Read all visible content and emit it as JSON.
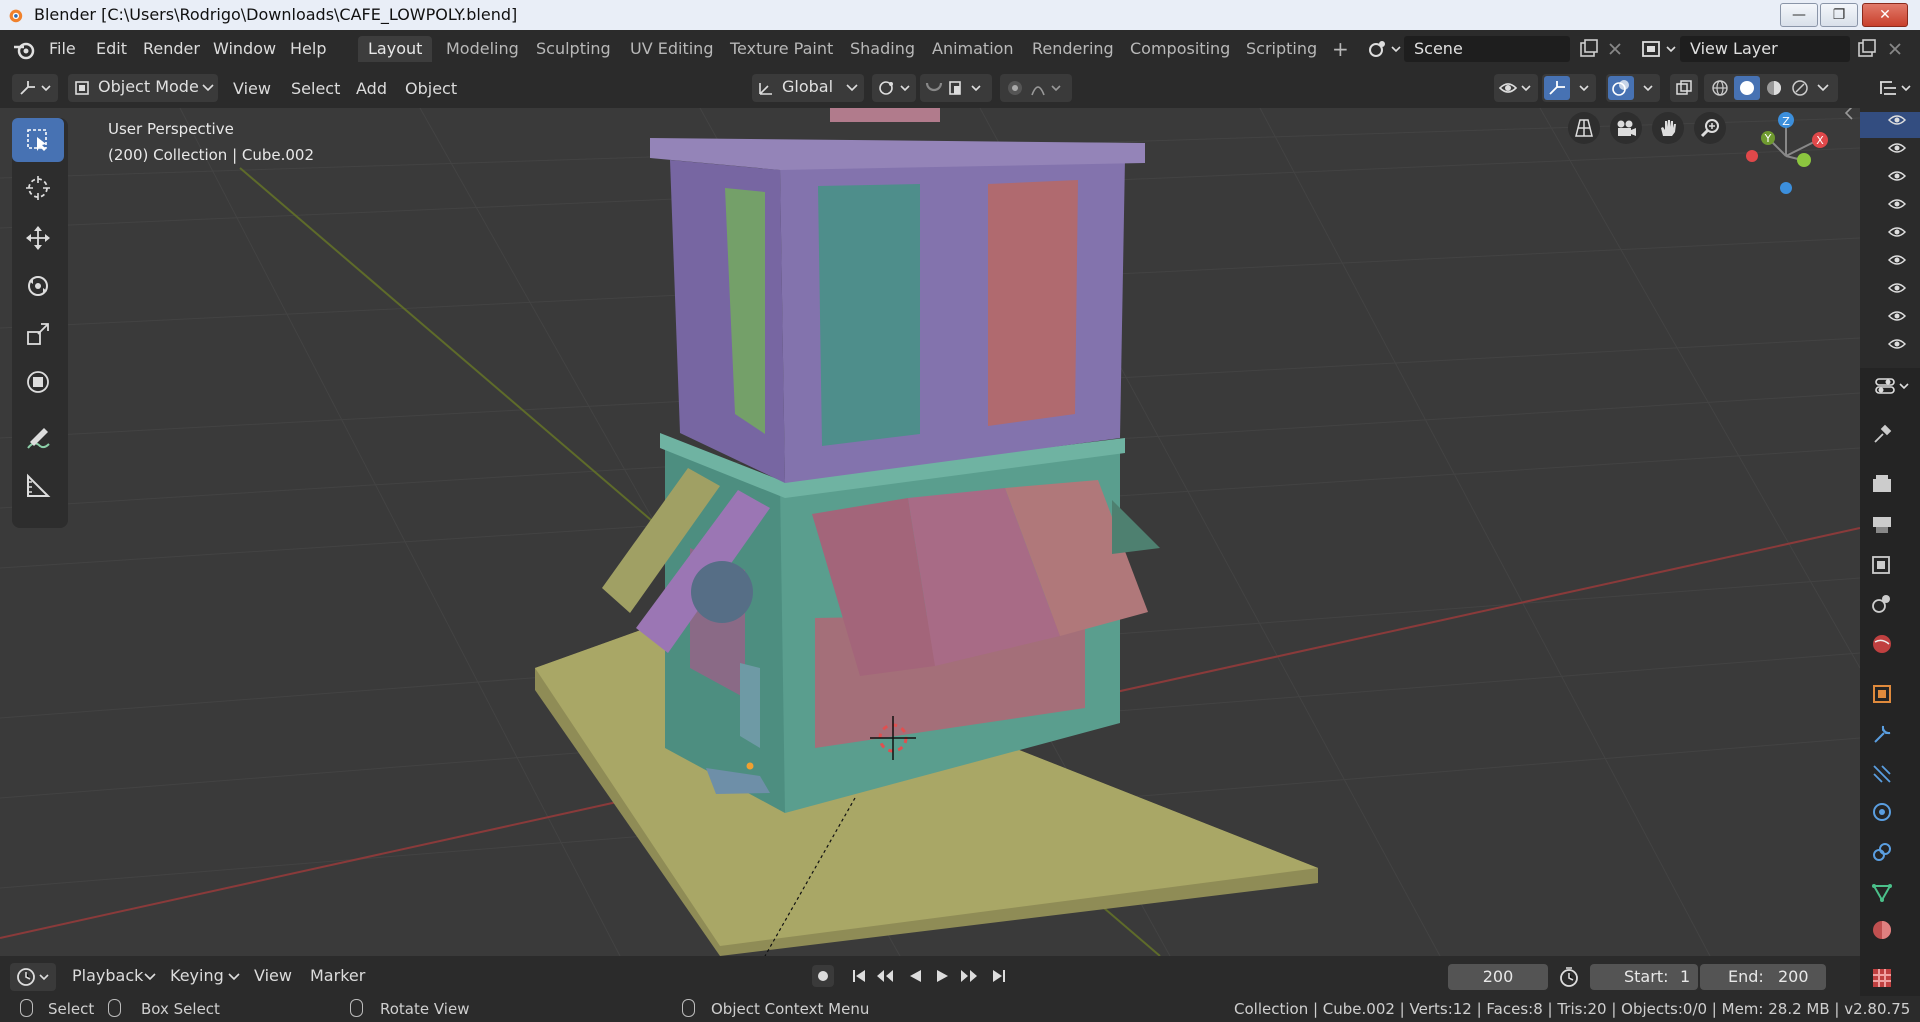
{
  "window": {
    "title": "Blender [C:\\Users\\Rodrigo\\Downloads\\CAFE_LOWPOLY.blend]",
    "min_symbol": "—",
    "restore_symbol": "❐",
    "close_symbol": "✕"
  },
  "menu": [
    "File",
    "Edit",
    "Render",
    "Window",
    "Help"
  ],
  "workspaces": [
    "Layout",
    "Modeling",
    "Sculpting",
    "UV Editing",
    "Texture Paint",
    "Shading",
    "Animation",
    "Rendering",
    "Compositing",
    "Scripting"
  ],
  "active_workspace": "Layout",
  "add_workspace": "+",
  "scene": {
    "name": "Scene"
  },
  "view_layer": {
    "name": "View Layer"
  },
  "header": {
    "mode": "Object Mode",
    "menus": [
      "View",
      "Select",
      "Add",
      "Object"
    ],
    "transform_orientation": "Global"
  },
  "viewport": {
    "perspective": "User Perspective",
    "context": "(200) Collection | Cube.002",
    "gizmo": {
      "x": "X",
      "y": "Y",
      "z": "Z"
    }
  },
  "tools": [
    "select-box",
    "cursor",
    "move",
    "rotate",
    "scale",
    "transform",
    "annotate",
    "measure"
  ],
  "outliner_visible_rows": 9,
  "timeline": {
    "menus": [
      "Playback",
      "Keying",
      "View",
      "Marker"
    ],
    "current_frame": "200",
    "start_label": "Start:",
    "start": "1",
    "end_label": "End:",
    "end": "200"
  },
  "status": {
    "select": "Select",
    "box_select": "Box Select",
    "rotate_view": "Rotate View",
    "context_menu": "Object Context Menu",
    "stats": "Collection | Cube.002 | Verts:12 | Faces:8 | Tris:20 | Objects:0/0 | Mem: 28.2 MB | v2.80.75"
  },
  "colors": {
    "accent": "#4772b3",
    "viewport_bg": "#3a3a3a",
    "x_axis": "#e0484a",
    "y_axis": "#8cc63f",
    "z_axis": "#3c8fdc"
  }
}
